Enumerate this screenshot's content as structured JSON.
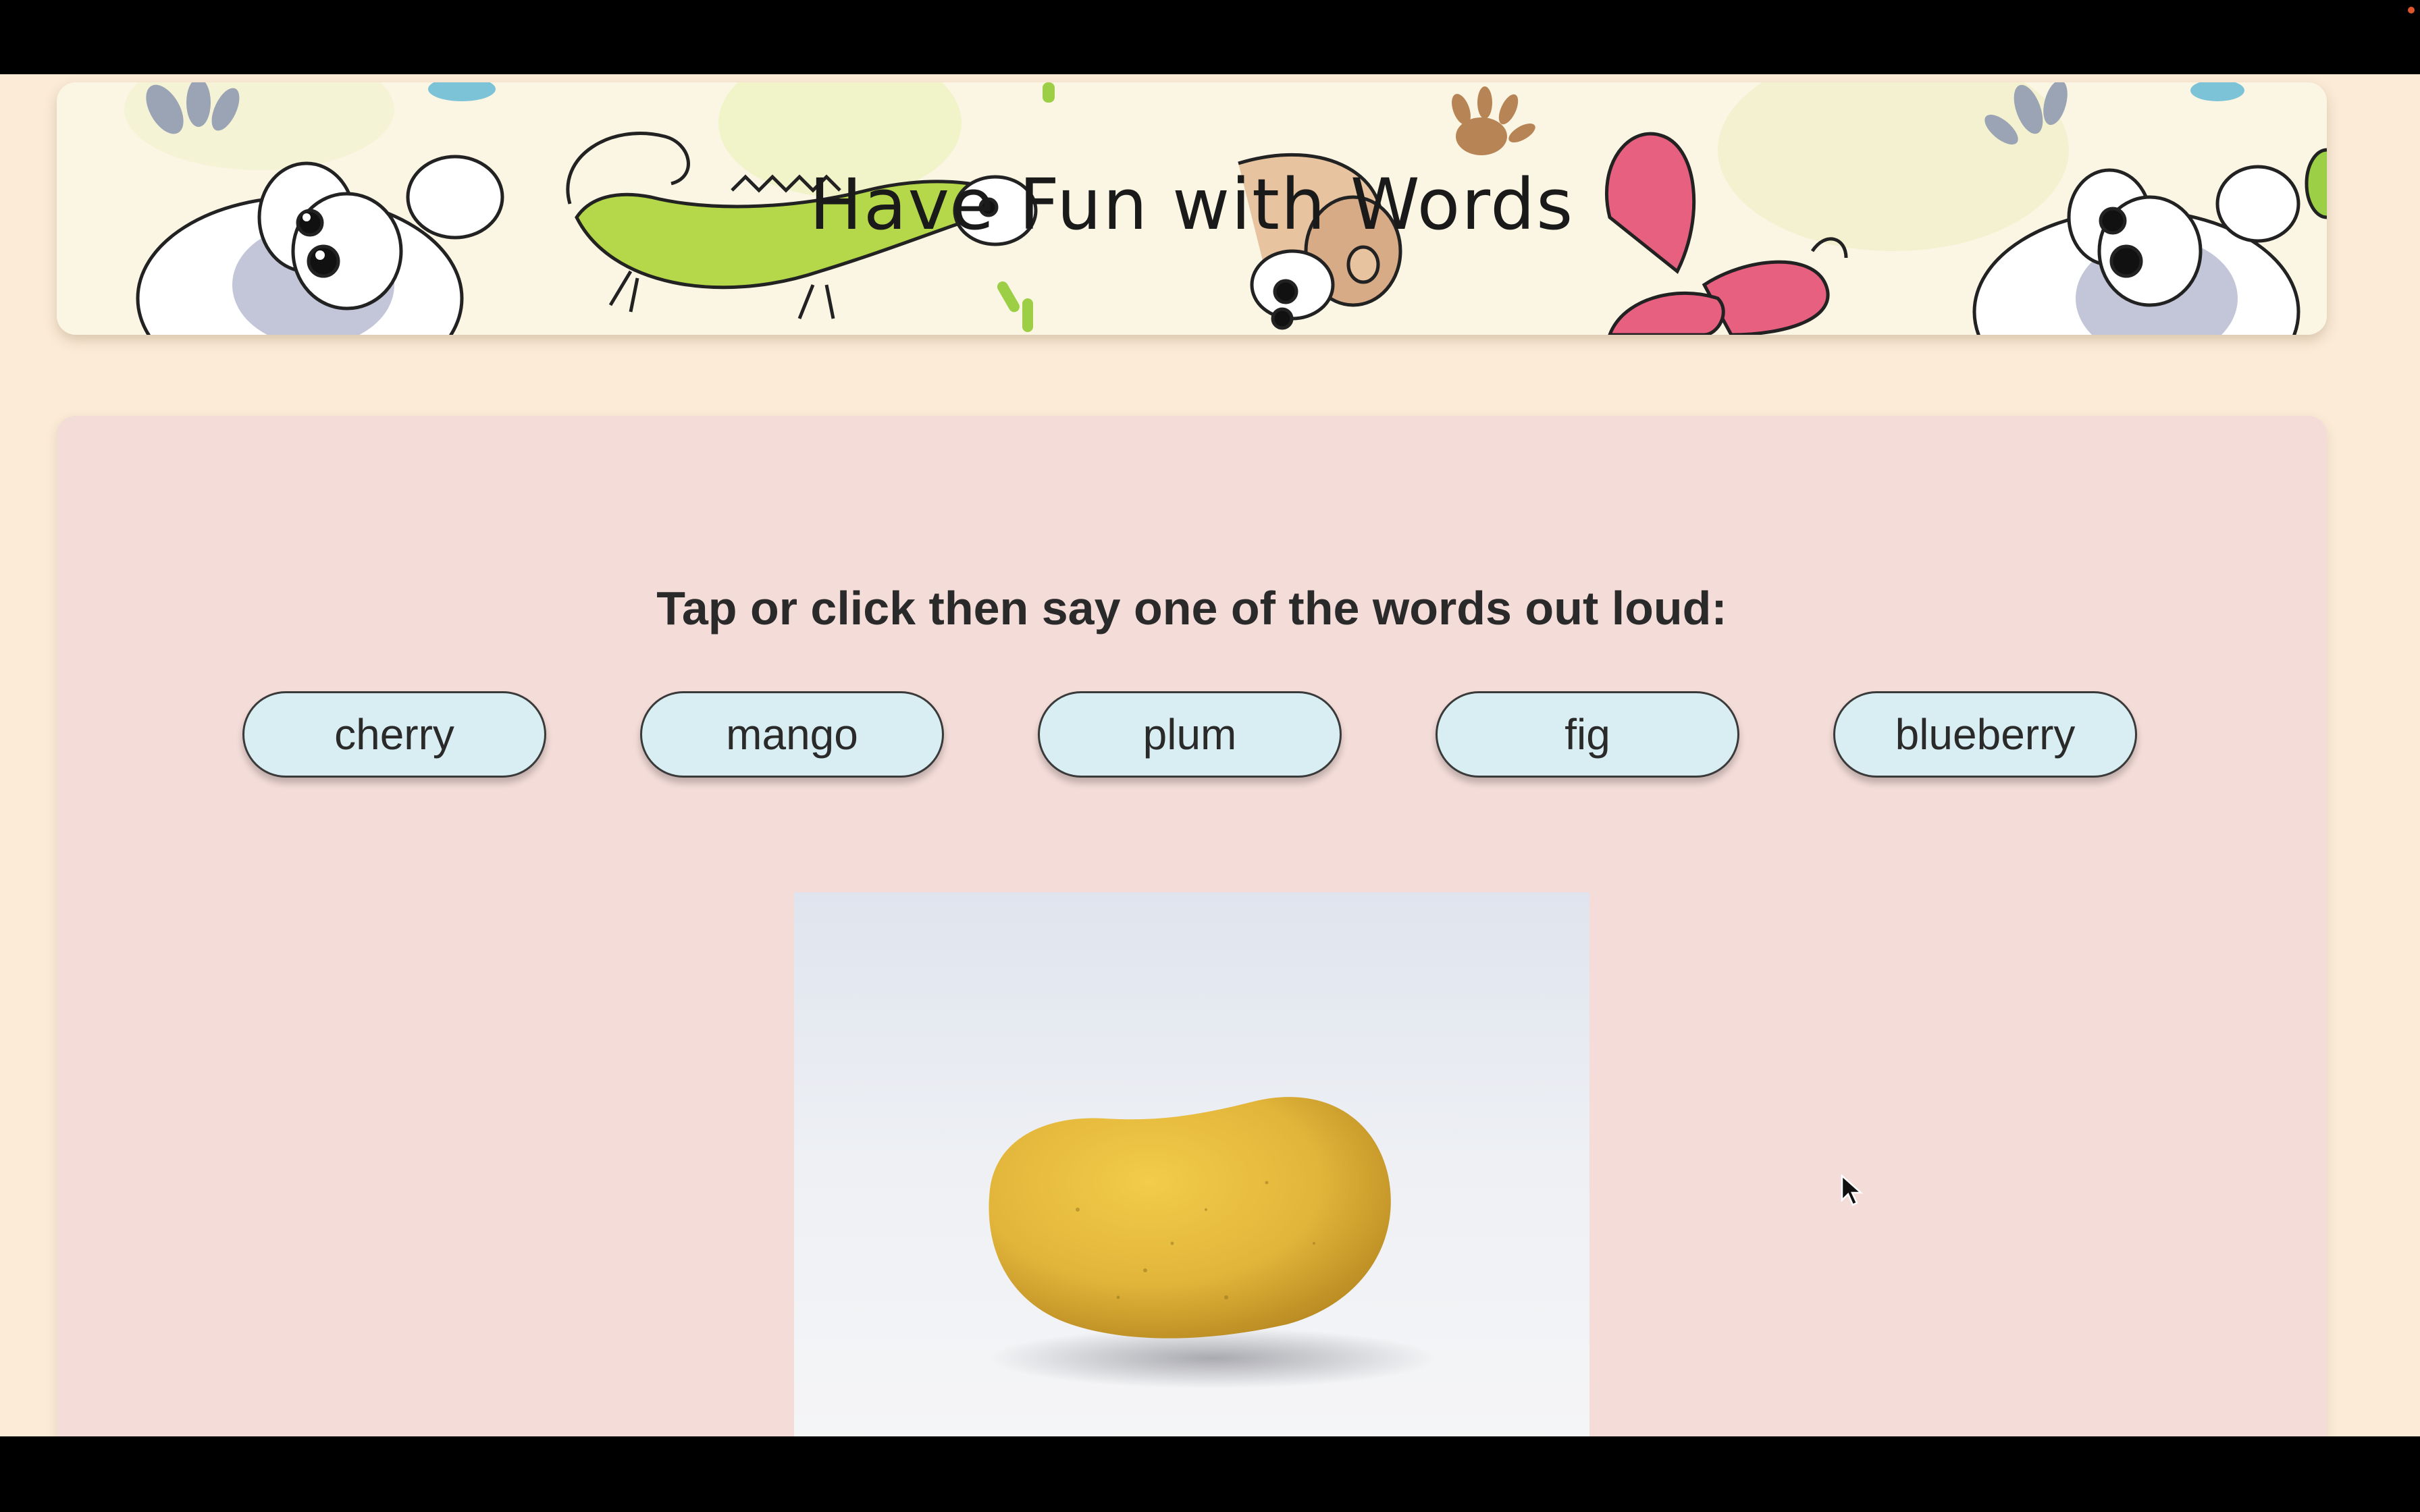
{
  "banner": {
    "title": "Have Fun with Words"
  },
  "activity": {
    "prompt": "Tap or click then say one of the words out loud:",
    "words": [
      {
        "label": "cherry"
      },
      {
        "label": "mango"
      },
      {
        "label": "plum"
      },
      {
        "label": "fig"
      },
      {
        "label": "blueberry"
      }
    ],
    "picture": {
      "icon": "mango-photo"
    }
  },
  "colors": {
    "page_background": "#fbebd7",
    "card_background": "#f4dcd8",
    "word_button": "#d8eef2",
    "mango": "#e2b53a"
  }
}
